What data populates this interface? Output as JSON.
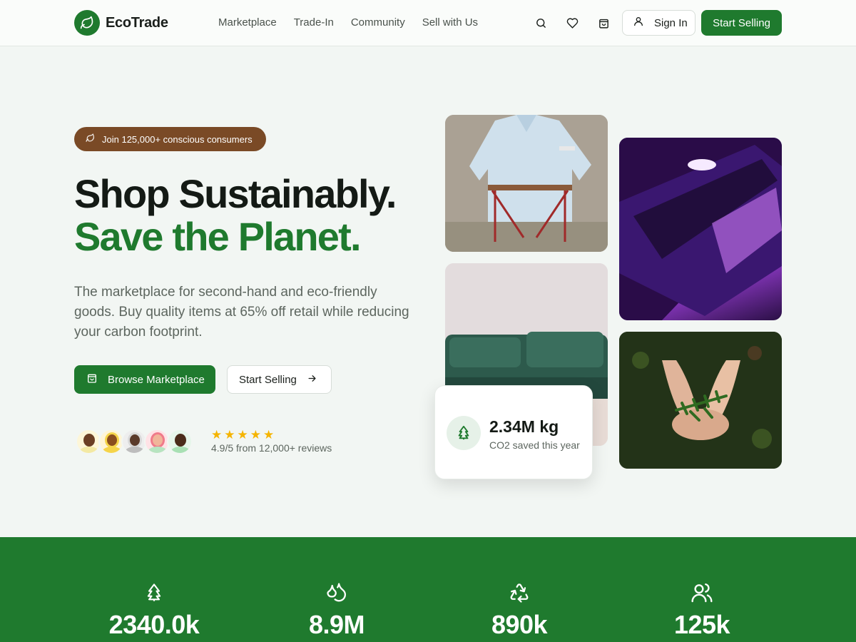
{
  "brand": {
    "name": "EcoTrade",
    "accent": "#1f7a2e",
    "secondary": "#7a4a26"
  },
  "nav": {
    "links": [
      "Marketplace",
      "Trade-In",
      "Community",
      "Sell with Us"
    ],
    "icons": [
      "search-icon",
      "heart-icon",
      "shopping-bag-icon"
    ],
    "sign_in": "Sign In",
    "start_selling": "Start Selling"
  },
  "hero": {
    "badge": "Join 125,000+ conscious consumers",
    "title_line1": "Shop Sustainably.",
    "title_line2": "Save the Planet.",
    "subtitle": "The marketplace for second-hand and eco-friendly goods. Buy quality items at 65% off retail while reducing your carbon footprint.",
    "primary_cta": "Browse Marketplace",
    "secondary_cta": "Start Selling",
    "rating_text": "4.9/5 from 12,000+ reviews",
    "stars": 5
  },
  "gallery": {
    "images": [
      "denim-shirt-on-chair",
      "purple-lit-laptop",
      "green-velvet-sofa",
      "hands-holding-seedling"
    ]
  },
  "co2_card": {
    "value": "2.34M kg",
    "label": "CO2 saved this year",
    "icon": "tree-icon"
  },
  "stats": [
    {
      "icon": "tree-icon",
      "value": "2340.0k"
    },
    {
      "icon": "water-drops-icon",
      "value": "8.9M"
    },
    {
      "icon": "recycle-icon",
      "value": "890k"
    },
    {
      "icon": "users-icon",
      "value": "125k"
    }
  ]
}
